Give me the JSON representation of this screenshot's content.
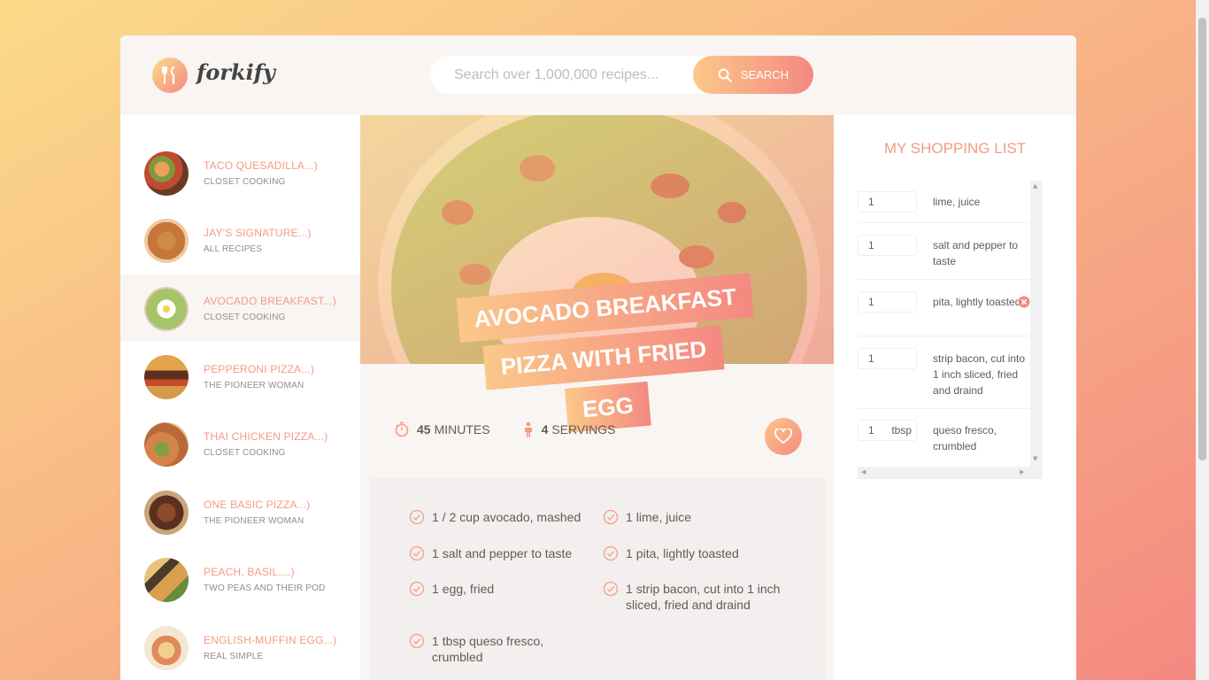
{
  "header": {
    "logo_text": "forkify",
    "search_placeholder": "Search over 1,000,000 recipes...",
    "search_button": "SEARCH"
  },
  "results": [
    {
      "title": "TACO QUESADILLA...)",
      "author": "CLOSET COOKING",
      "active": false
    },
    {
      "title": "JAY'S SIGNATURE...)",
      "author": "ALL RECIPES",
      "active": false
    },
    {
      "title": "AVOCADO BREAKFAST...)",
      "author": "CLOSET COOKING",
      "active": true
    },
    {
      "title": "PEPPERONI PIZZA...)",
      "author": "THE PIONEER WOMAN",
      "active": false
    },
    {
      "title": "THAI CHICKEN PIZZA...)",
      "author": "CLOSET COOKING",
      "active": false
    },
    {
      "title": "ONE BASIC PIZZA...)",
      "author": "THE PIONEER WOMAN",
      "active": false
    },
    {
      "title": "PEACH, BASIL,...)",
      "author": "TWO PEAS AND THEIR POD",
      "active": false
    },
    {
      "title": "ENGLISH-MUFFIN EGG...)",
      "author": "REAL SIMPLE",
      "active": false
    }
  ],
  "recipe": {
    "title": "AVOCADO BREAKFAST PIZZA WITH FRIED EGG",
    "minutes_value": "45",
    "minutes_label": "MINUTES",
    "servings_value": "4",
    "servings_label": "SERVINGS",
    "ingredients": [
      {
        "count": "1 / 2",
        "text": "cup avocado, mashed"
      },
      {
        "count": "1",
        "text": "lime, juice"
      },
      {
        "count": "1",
        "text": "salt and pepper to taste"
      },
      {
        "count": "1",
        "text": "pita, lightly toasted"
      },
      {
        "count": "1",
        "text": "egg, fried"
      },
      {
        "count": "1",
        "text": "strip bacon, cut into 1 inch sliced, fried and draind"
      },
      {
        "count": "1",
        "text": "tbsp queso fresco, crumbled"
      }
    ]
  },
  "shopping": {
    "title": "MY SHOPPING LIST",
    "items": [
      {
        "count": "1",
        "unit": "",
        "text": "lime, juice"
      },
      {
        "count": "1",
        "unit": "",
        "text": "salt and pepper to taste"
      },
      {
        "count": "1",
        "unit": "",
        "text": "pita, lightly toasted"
      },
      {
        "count": "1",
        "unit": "",
        "text": "strip bacon, cut into 1 inch sliced, fried and draind"
      },
      {
        "count": "1",
        "unit": "tbsp",
        "text": "queso fresco, crumbled"
      }
    ]
  },
  "colors": {
    "accent": "#f59a83",
    "grad_start": "#fbdb89",
    "grad_end": "#f48982"
  }
}
